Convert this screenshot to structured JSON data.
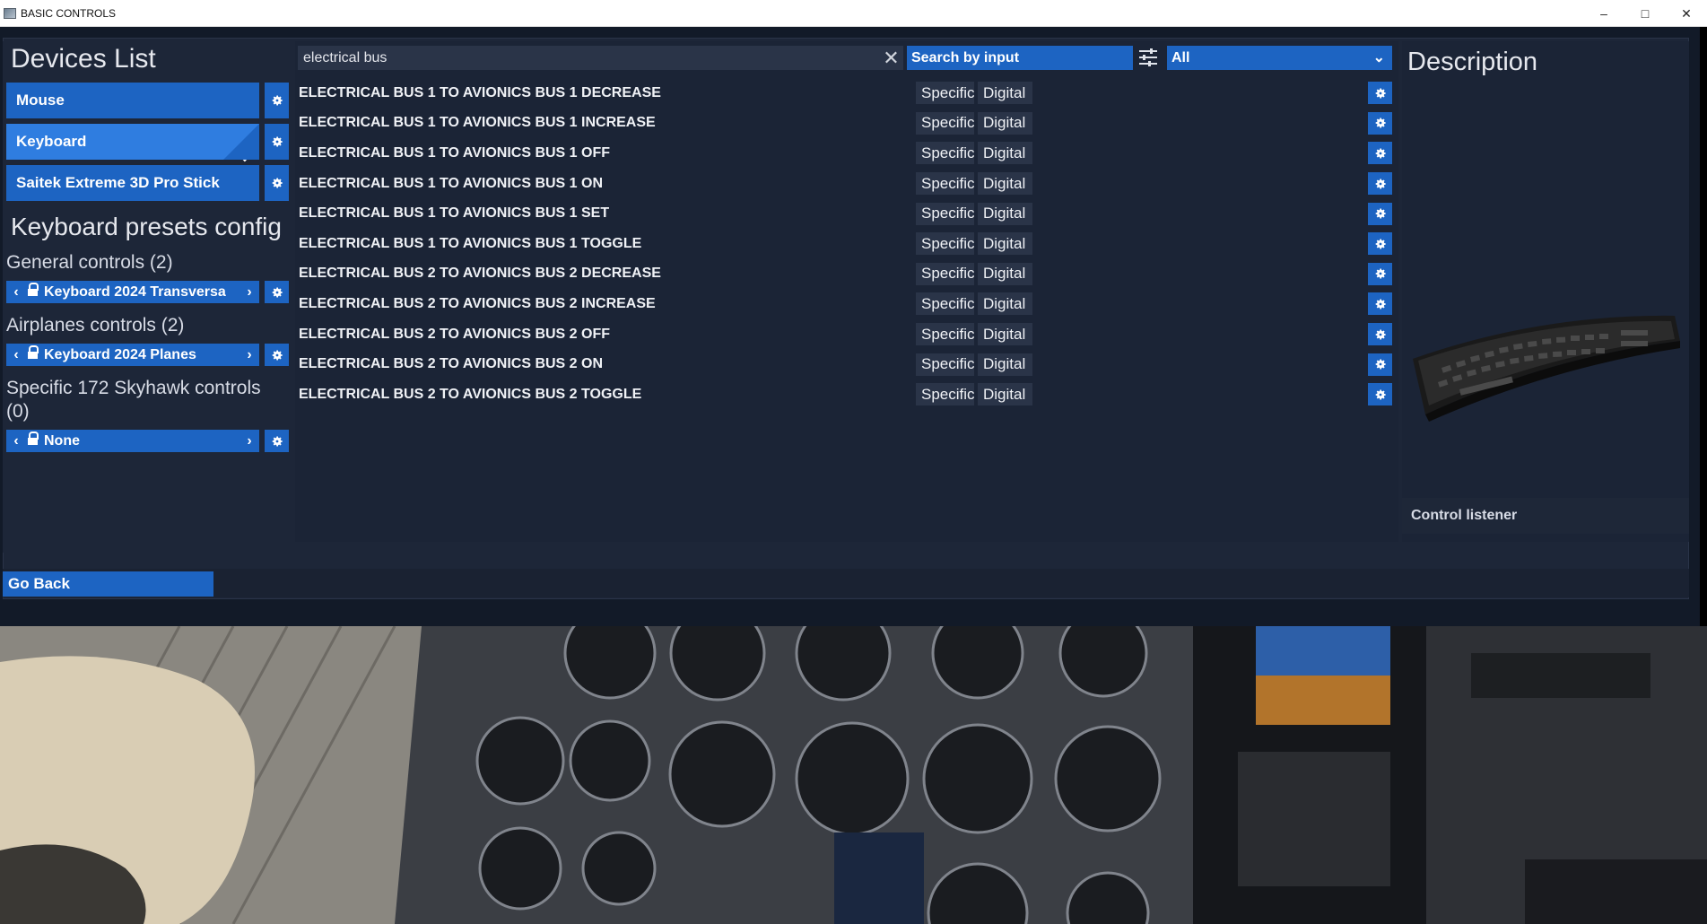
{
  "window": {
    "title": "BASIC CONTROLS",
    "minimize": "–",
    "maximize": "□",
    "close": "✕"
  },
  "devices": {
    "heading": "Devices List",
    "items": [
      {
        "label": "Mouse",
        "selected": false
      },
      {
        "label": "Keyboard",
        "selected": true
      },
      {
        "label": "Saitek Extreme 3D Pro Stick",
        "selected": false
      }
    ]
  },
  "presets": {
    "heading": "Keyboard presets config",
    "groups": [
      {
        "title": "General controls (2)",
        "preset": "Keyboard 2024 Transversa"
      },
      {
        "title": "Airplanes controls (2)",
        "preset": "Keyboard 2024 Planes"
      },
      {
        "title": "Specific 172 Skyhawk controls (0)",
        "preset": "None"
      }
    ]
  },
  "search": {
    "value": "electrical bus",
    "mode": "Search by input",
    "filter": "All"
  },
  "controls": [
    {
      "name": "ELECTRICAL BUS 1 TO AVIONICS BUS 1 DECREASE",
      "scope": "Specific",
      "type": "Digital"
    },
    {
      "name": "ELECTRICAL BUS 1 TO AVIONICS BUS 1 INCREASE",
      "scope": "Specific",
      "type": "Digital"
    },
    {
      "name": "ELECTRICAL BUS 1 TO AVIONICS BUS 1 OFF",
      "scope": "Specific",
      "type": "Digital"
    },
    {
      "name": "ELECTRICAL BUS 1 TO AVIONICS BUS 1 ON",
      "scope": "Specific",
      "type": "Digital"
    },
    {
      "name": "ELECTRICAL BUS 1 TO AVIONICS BUS 1 SET",
      "scope": "Specific",
      "type": "Digital"
    },
    {
      "name": "ELECTRICAL BUS 1 TO AVIONICS BUS 1 TOGGLE",
      "scope": "Specific",
      "type": "Digital"
    },
    {
      "name": "ELECTRICAL BUS 2 TO AVIONICS BUS 2 DECREASE",
      "scope": "Specific",
      "type": "Digital"
    },
    {
      "name": "ELECTRICAL BUS 2 TO AVIONICS BUS 2 INCREASE",
      "scope": "Specific",
      "type": "Digital"
    },
    {
      "name": "ELECTRICAL BUS 2 TO AVIONICS BUS 2 OFF",
      "scope": "Specific",
      "type": "Digital"
    },
    {
      "name": "ELECTRICAL BUS 2 TO AVIONICS BUS 2 ON",
      "scope": "Specific",
      "type": "Digital"
    },
    {
      "name": "ELECTRICAL BUS 2 TO AVIONICS BUS 2 TOGGLE",
      "scope": "Specific",
      "type": "Digital"
    }
  ],
  "description": {
    "heading": "Description",
    "device_image": "keyboard-illustration",
    "control_listener": "Control listener"
  },
  "footer": {
    "go_back": "Go Back"
  },
  "colors": {
    "accent": "#1d64c2",
    "panel": "#1d2638",
    "text": "#f0f2f6"
  }
}
